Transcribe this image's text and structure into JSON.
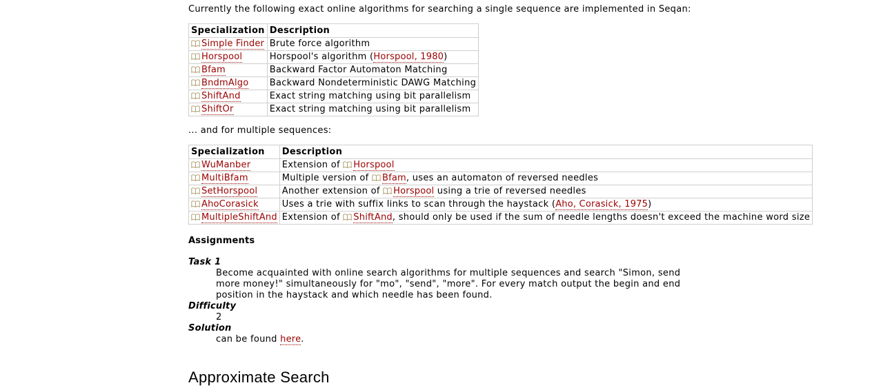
{
  "intro_text": "Currently the following exact online algorithms for searching a single sequence are implemented in Seqan:",
  "single_table": {
    "header_specialization": "Specialization",
    "header_description": "Description",
    "rows": [
      {
        "name": "Simple Finder",
        "desc": "Brute force algorithm"
      },
      {
        "name": "Horspool",
        "desc_before": "Horspool's algorithm (",
        "ref": "Horspool, 1980",
        "desc_after": ")"
      },
      {
        "name": "Bfam",
        "desc": "Backward Factor Automaton Matching"
      },
      {
        "name": "BndmAlgo",
        "desc": "Backward Nondeterministic DAWG Matching"
      },
      {
        "name": "ShiftAnd",
        "desc": "Exact string matching using bit parallelism"
      },
      {
        "name": "ShiftOr",
        "desc": "Exact string matching using bit parallelism"
      }
    ]
  },
  "multi_intro": "... and for multiple sequences:",
  "multi_table": {
    "header_specialization": "Specialization",
    "header_description": "Description",
    "rows": [
      {
        "name": "WuManber",
        "d1": "Extension of ",
        "link": "Horspool"
      },
      {
        "name": "MultiBfam",
        "d1": "Multiple version of ",
        "link": "Bfam",
        "d2": ", uses an automaton of reversed needles"
      },
      {
        "name": "SetHorspool",
        "d1": "Another extension of ",
        "link": "Horspool",
        "d2": " using a trie of reversed needles"
      },
      {
        "name": "AhoCorasick",
        "d1": "Uses a trie with suffix links to scan through the haystack (",
        "ref": "Aho, Corasick, 1975",
        "d2": ")"
      },
      {
        "name": "MultipleShiftAnd",
        "d1": "Extension of ",
        "link": "ShiftAnd",
        "d2": ", should only be used if the sum of needle lengths doesn't exceed the machine word size"
      }
    ]
  },
  "assignments": {
    "heading": "Assignments",
    "task_label": "Task 1",
    "task_text": "Become acquainted with online search algorithms for multiple sequences and search \"Simon, send more money!\" simultaneously for \"mo\", \"send\", \"more\". For every match output the begin and end position in the haystack and which needle has been found.",
    "difficulty_label": "Difficulty",
    "difficulty_value": "2",
    "solution_label": "Solution",
    "solution_before": "can be found ",
    "solution_link": "here",
    "solution_after": "."
  },
  "next_section_title": "Approximate Search",
  "colors": {
    "link": "#9a0000",
    "border": "#cfcfcf"
  },
  "icons": {
    "doc_link": "book-icon"
  }
}
